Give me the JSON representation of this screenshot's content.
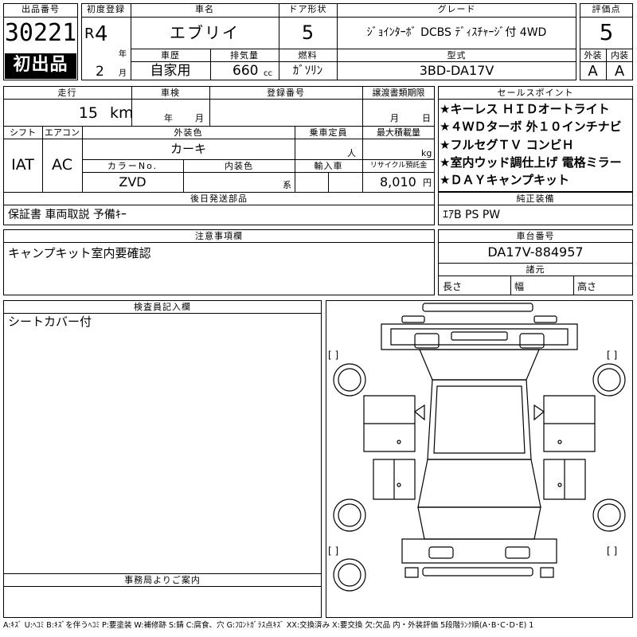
{
  "lot": {
    "label": "出品番号",
    "number": "30221",
    "badge": "初出品"
  },
  "first_reg": {
    "label": "初度登録",
    "era": "R",
    "year": "4",
    "year_unit": "年",
    "month": "2",
    "month_unit": "月"
  },
  "car_name": {
    "label": "車名",
    "value": "エブリイ"
  },
  "doors": {
    "label": "ドア形状",
    "value": "5"
  },
  "grade": {
    "label": "グレード",
    "value": "ｼﾞｮｲﾝﾀｰﾎﾞ DCBS ﾃﾞｨｽﾁｬｰｼﾞ付 4WD"
  },
  "score": {
    "label": "評価点",
    "value": "5",
    "ext_label": "外装",
    "int_label": "内装",
    "ext_value": "A",
    "int_value": "A"
  },
  "history": {
    "label": "車歴",
    "value": "自家用"
  },
  "displacement": {
    "label": "排気量",
    "value": "660",
    "unit": "cc"
  },
  "fuel": {
    "label": "燃料",
    "value": "ｶﾞｿﾘﾝ"
  },
  "model": {
    "label": "型式",
    "value": "3BD-DA17V"
  },
  "mileage": {
    "label": "走行",
    "value": "15",
    "unit": "km"
  },
  "inspection": {
    "label": "車検",
    "year_unit": "年",
    "month_unit": "月"
  },
  "registration_no": {
    "label": "登録番号"
  },
  "transfer_deadline": {
    "label": "譲渡書類期限",
    "month_unit": "月",
    "day_unit": "日"
  },
  "shift": {
    "label": "シフト",
    "value": "IAT"
  },
  "aircon": {
    "label": "エアコン",
    "value": "AC"
  },
  "ext_color": {
    "label": "外装色",
    "value": "カーキ"
  },
  "capacity": {
    "label": "乗車定員",
    "unit": "人"
  },
  "max_load": {
    "label": "最大積載量",
    "unit": "kg"
  },
  "color_no": {
    "label": "カラーNo.",
    "value": "ZVD"
  },
  "int_color": {
    "label": "内装色",
    "unit": "系"
  },
  "import": {
    "label": "輸入車"
  },
  "recycle": {
    "label": "リサイクル預託金",
    "value": "8,010",
    "unit": "円"
  },
  "later_parts": {
    "label": "後日発送部品",
    "value": "保証書 車両取説 予備ｷｰ"
  },
  "sales_points": {
    "label": "セールスポイント",
    "items": [
      "★キーレス ＨＩＤオートライト",
      "★４ＷＤターボ 外１０インチナビ",
      "★フルセグＴＶ コンビＨ",
      "★室内ウッド調仕上げ 電格ミラー",
      "★ＤＡＹキャンプキット"
    ]
  },
  "standard_equipment": {
    "label": "純正装備",
    "value": "ｴｱB PS PW"
  },
  "caution": {
    "label": "注意事項欄",
    "value": "キャンプキット室内要確認"
  },
  "chassis": {
    "label": "車台番号",
    "value": "DA17V-884957"
  },
  "dimensions": {
    "label": "諸元",
    "length": "長さ",
    "width": "幅",
    "height": "高さ"
  },
  "inspector": {
    "label": "検査員記入欄",
    "value": "シートカバー付"
  },
  "office": {
    "label": "事務局よりご案内"
  },
  "legend": "A:ｷｽﾞ U:ﾍｺﾐ B:ｷｽﾞを伴うﾍｺﾐ P:要塗装 W:補修跡 S:錆 C:腐食、穴 G:ﾌﾛﾝﾄｶﾞﾗｽ点ｷｽﾞ XX:交換済み X:要交換 欠:欠品 内・外装評価 5段階ﾗﾝｸ順(A･B･C･D･E) 1",
  "diagram": {
    "bracket": "[ ]"
  }
}
